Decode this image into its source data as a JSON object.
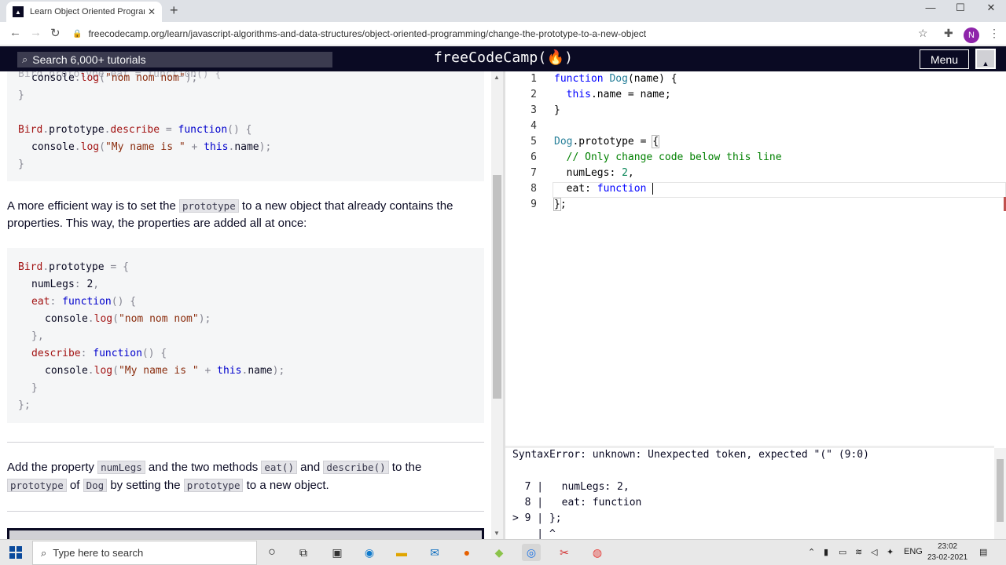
{
  "browser": {
    "tab_title": "Learn Object Oriented Programm",
    "url": "freecodecamp.org/learn/javascript-algorithms-and-data-structures/object-oriented-programming/change-the-prototype-to-a-new-object",
    "profile_initial": "N"
  },
  "fcc_nav": {
    "search_placeholder": "Search 6,000+ tutorials",
    "logo": "freeCodeCamp(🔥)",
    "menu_label": "Menu"
  },
  "lesson": {
    "para1_a": "A more efficient way is to set the ",
    "para1_code": "prototype",
    "para1_b": " to a new object that already contains the properties. This way, the properties are added all at once:",
    "para2_a": "Add the property ",
    "para2_code1": "numLegs",
    "para2_b": " and the two methods ",
    "para2_code2": "eat()",
    "para2_c": " and ",
    "para2_code3": "describe()",
    "para2_d": " to the ",
    "para2_code4": "prototype",
    "para2_e": " of ",
    "para2_code5": "Dog",
    "para2_f": " by setting the ",
    "para2_code6": "prototype",
    "para2_g": " to a new object."
  },
  "editor": {
    "line_numbers": [
      "1",
      "2",
      "3",
      "4",
      "5",
      "6",
      "7",
      "8",
      "9"
    ]
  },
  "console": {
    "error": "SyntaxError: unknown: Unexpected token, expected \"(\" (9:0)",
    "frame": [
      "  7 |   numLegs: 2,",
      "  8 |   eat: function",
      "> 9 | };",
      "    | ^"
    ]
  },
  "taskbar": {
    "search_placeholder": "Type here to search",
    "lang": "ENG",
    "time": "23:02",
    "date": "23-02-2021"
  }
}
